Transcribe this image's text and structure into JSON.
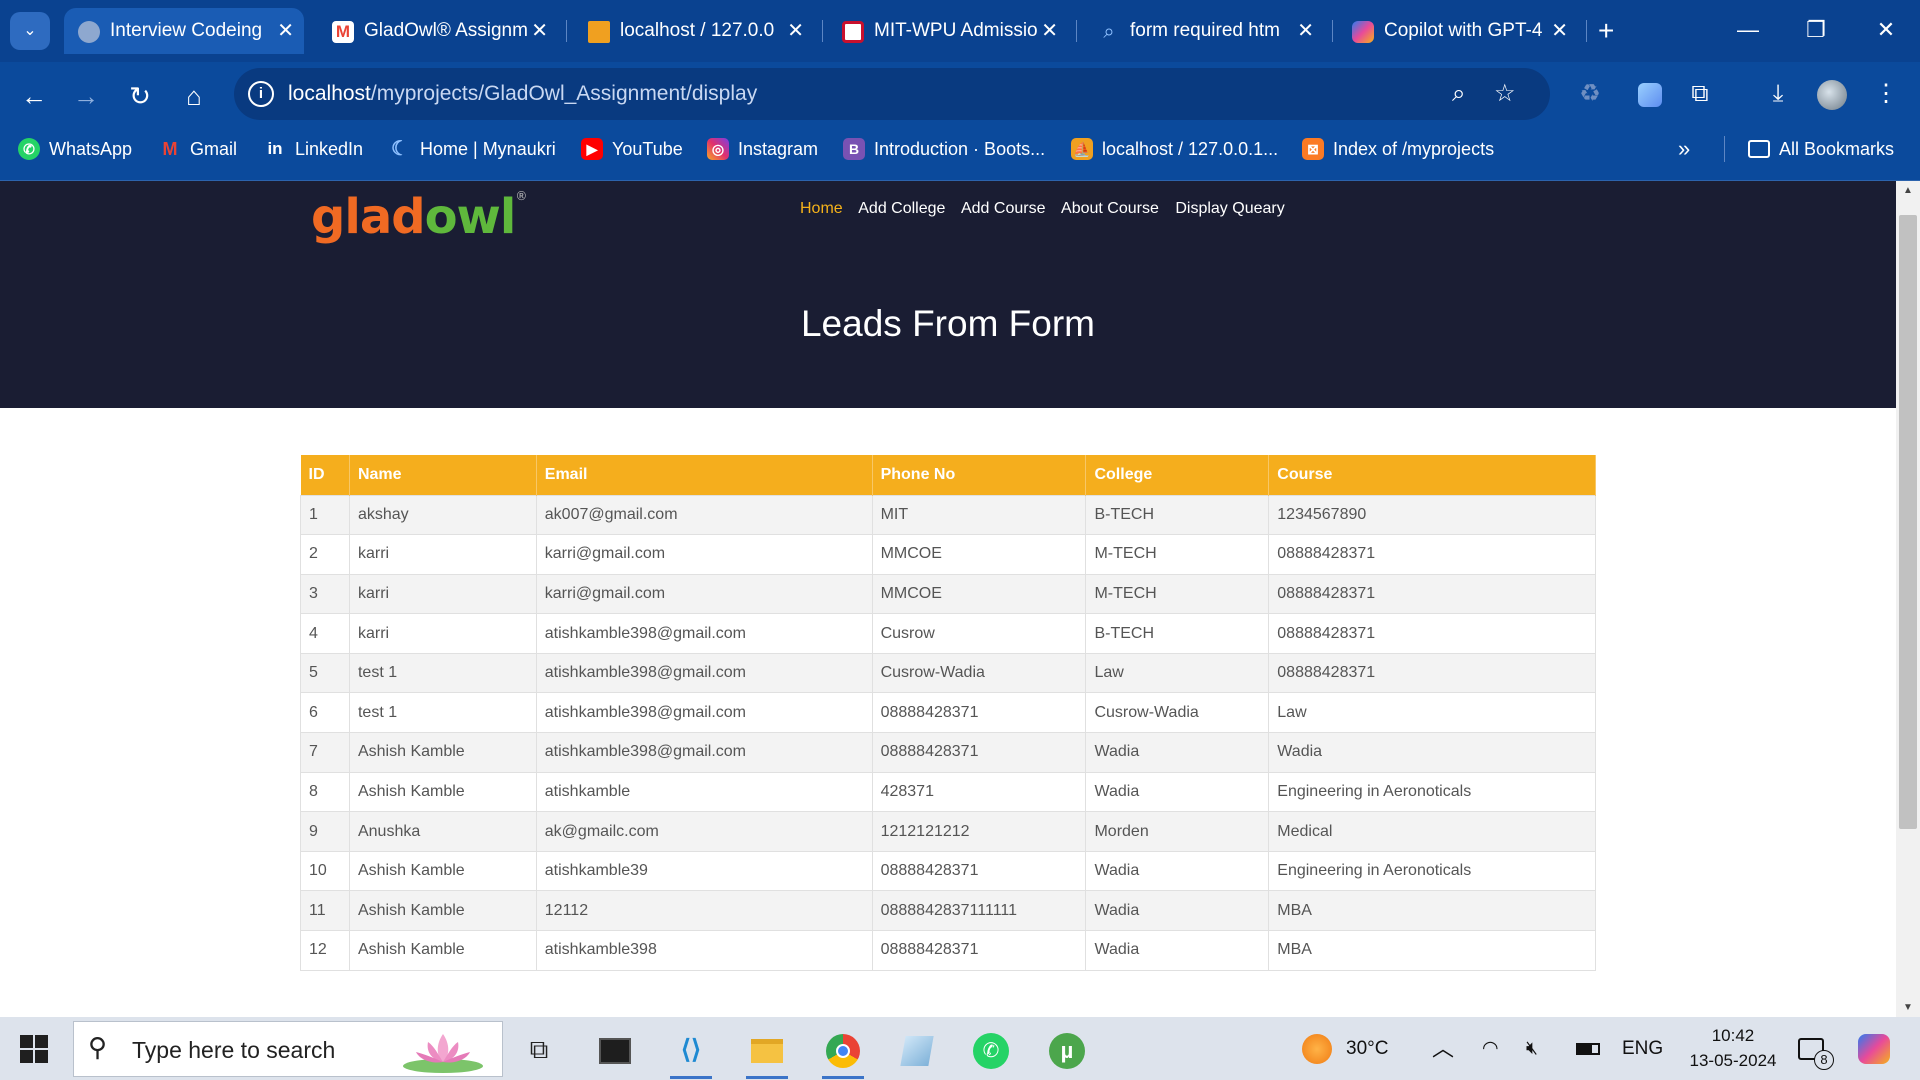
{
  "browser": {
    "tabs": [
      {
        "title": "Interview Codeing",
        "icon": "globe-icon",
        "active": true
      },
      {
        "title": "GladOwl® Assignm",
        "icon": "gmail-icon",
        "active": false
      },
      {
        "title": "localhost / 127.0.0",
        "icon": "phpmyadmin-icon",
        "active": false
      },
      {
        "title": "MIT-WPU Admissio",
        "icon": "mitwpu-icon",
        "active": false
      },
      {
        "title": "form required htm",
        "icon": "search-icon",
        "active": false
      },
      {
        "title": "Copilot with GPT-4",
        "icon": "copilot-icon",
        "active": false
      }
    ],
    "address": {
      "host": "localhost",
      "path": "/myprojects/GladOwl_Assignment/display"
    },
    "bookmarks": [
      {
        "label": "WhatsApp",
        "icon": "whatsapp-icon",
        "color": "#25d366"
      },
      {
        "label": "Gmail",
        "icon": "gmail-icon",
        "color": "#ea4335"
      },
      {
        "label": "LinkedIn",
        "icon": "linkedin-icon",
        "color": "#0a66c2"
      },
      {
        "label": "Home | Mynaukri",
        "icon": "naukri-icon",
        "color": "#4a90e2"
      },
      {
        "label": "YouTube",
        "icon": "youtube-icon",
        "color": "#ff0000"
      },
      {
        "label": "Instagram",
        "icon": "instagram-icon",
        "color": "#e1306c"
      },
      {
        "label": "Introduction · Boots...",
        "icon": "bootstrap-icon",
        "color": "#7952b3"
      },
      {
        "label": "localhost / 127.0.0.1...",
        "icon": "phpmyadmin-icon",
        "color": "#f0a020"
      },
      {
        "label": "Index of /myprojects",
        "icon": "xampp-icon",
        "color": "#fb7a24"
      }
    ],
    "all_bookmarks": "All Bookmarks"
  },
  "site": {
    "logo": {
      "part1": "glad",
      "part2": "owl",
      "mark": "®"
    },
    "nav": [
      "Home",
      "Add College",
      "Add Course",
      "About Course",
      "Display Queary"
    ],
    "page_title": "Leads From Form"
  },
  "table": {
    "headers": [
      "ID",
      "Name",
      "Email",
      "Phone No",
      "College",
      "Course"
    ],
    "rows": [
      [
        "1",
        "akshay",
        "ak007@gmail.com",
        "MIT",
        "B-TECH",
        "1234567890"
      ],
      [
        "2",
        "karri",
        "karri@gmail.com",
        "MMCOE",
        "M-TECH",
        "08888428371"
      ],
      [
        "3",
        "karri",
        "karri@gmail.com",
        "MMCOE",
        "M-TECH",
        "08888428371"
      ],
      [
        "4",
        "karri",
        "atishkamble398@gmail.com",
        "Cusrow",
        "B-TECH",
        "08888428371"
      ],
      [
        "5",
        "test 1",
        "atishkamble398@gmail.com",
        "Cusrow-Wadia",
        "Law",
        "08888428371"
      ],
      [
        "6",
        "test 1",
        "atishkamble398@gmail.com",
        "08888428371",
        "Cusrow-Wadia",
        "Law"
      ],
      [
        "7",
        "Ashish Kamble",
        "atishkamble398@gmail.com",
        "08888428371",
        "Wadia",
        "Wadia"
      ],
      [
        "8",
        "Ashish Kamble",
        "atishkamble",
        "428371",
        "Wadia",
        "Engineering in Aeronoticals"
      ],
      [
        "9",
        "Anushka",
        "ak@gmailc.com",
        "1212121212",
        "Morden",
        "Medical"
      ],
      [
        "10",
        "Ashish Kamble",
        "atishkamble39",
        "08888428371",
        "Wadia",
        "Engineering in Aeronoticals"
      ],
      [
        "11",
        "Ashish Kamble",
        "12112",
        "0888842837111111",
        "Wadia",
        "MBA"
      ],
      [
        "12",
        "Ashish Kamble",
        "atishkamble398",
        "08888428371",
        "Wadia",
        "MBA"
      ]
    ]
  },
  "taskbar": {
    "search_placeholder": "Type here to search",
    "apps": [
      "task-view-icon",
      "terminal-icon",
      "vscode-icon",
      "file-explorer-icon",
      "chrome-icon",
      "notepad-icon",
      "whatsapp-icon",
      "utorrent-icon"
    ],
    "weather": "30°C",
    "language": "ENG",
    "time": "10:42",
    "date": "13-05-2024",
    "notifications": "8"
  },
  "colors": {
    "header_bg": "#1a1d33",
    "table_header": "#f5ae1d",
    "nav_active": "#f5b21a",
    "chrome_blue": "#0b4a9c"
  }
}
